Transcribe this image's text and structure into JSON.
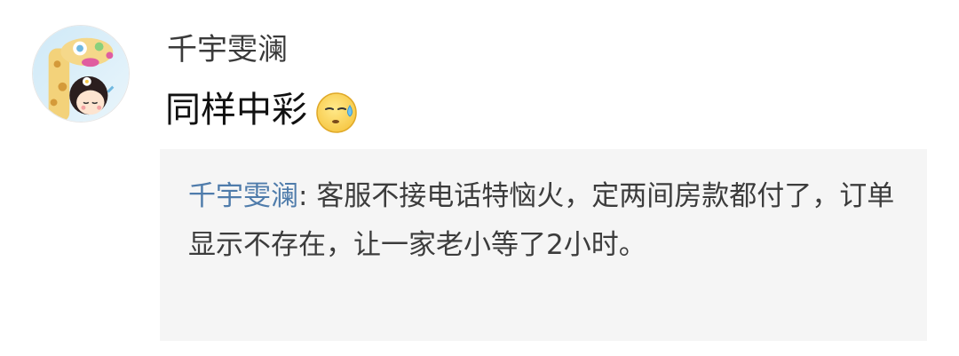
{
  "comment": {
    "avatar_icon": "cartoon-girl-avatar-icon",
    "author": "千宇雯澜",
    "text": "同样中彩",
    "emoji_icon": "sweat-face-emoji-icon"
  },
  "quote": {
    "author": "千宇雯澜",
    "separator": ": ",
    "text": "客服不接电话特恼火，定两间房款都付了，订单显示不存在，让一家老小等了2小时。"
  },
  "colors": {
    "background": "#ffffff",
    "quote_background": "#f5f5f5",
    "link_author": "#4f7cab",
    "text_primary": "#111111",
    "text_secondary": "#3a3a3a"
  }
}
